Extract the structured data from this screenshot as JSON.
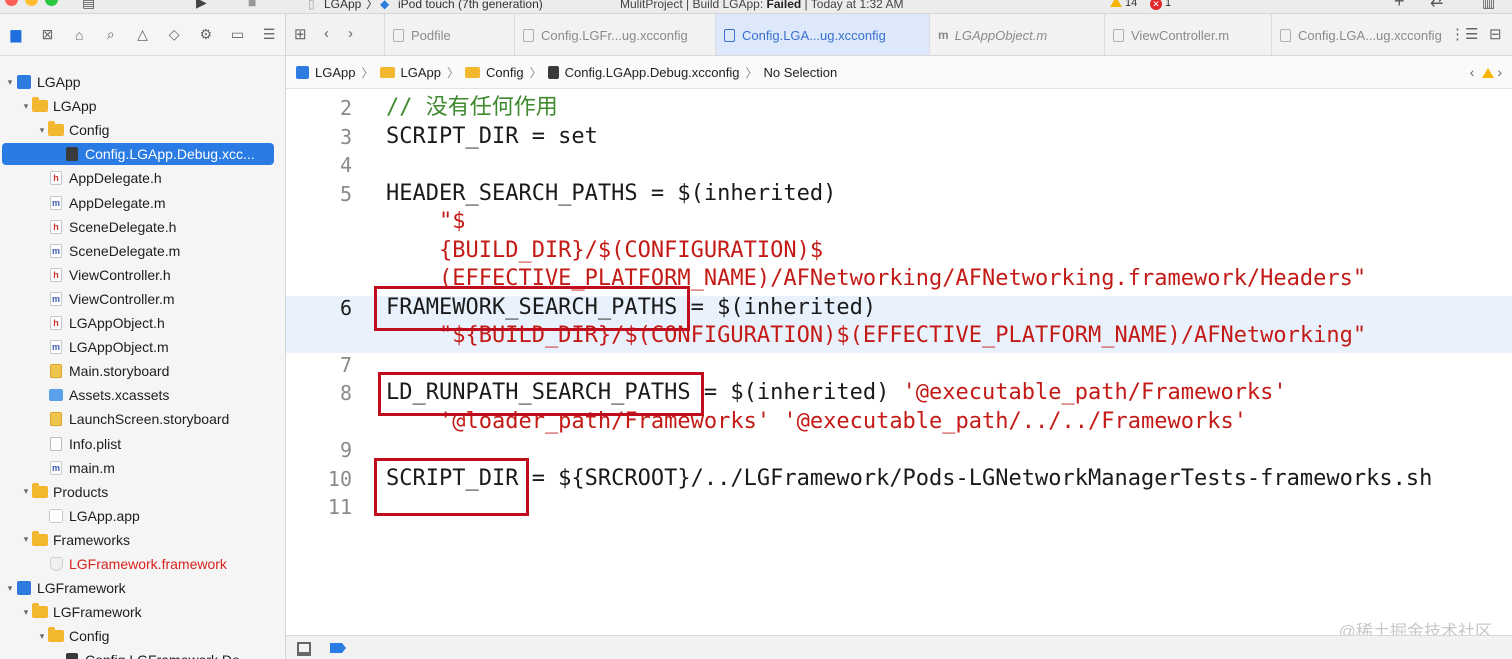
{
  "titlebar": {
    "scheme": "LGApp",
    "device": "iPod touch (7th generation)",
    "status_prefix": "MulitProject | Build LGApp: ",
    "status_result": "Failed",
    "status_suffix": " | Today at 1:32 AM",
    "warnings": "14",
    "errors": "1",
    "add_icon": "+",
    "swap_icon": "⇄"
  },
  "navigator": {
    "toolbar_icons": [
      "folder-icon",
      "source-control-icon",
      "symbols-icon",
      "search-icon",
      "issues-icon",
      "tests-icon",
      "debug-icon",
      "breakpoints-icon",
      "reports-icon"
    ],
    "tree": [
      {
        "label": "LGApp",
        "depth": 0,
        "icon": "project",
        "disclosure": "▾"
      },
      {
        "label": "LGApp",
        "depth": 1,
        "icon": "folder",
        "disclosure": "▾"
      },
      {
        "label": "Config",
        "depth": 2,
        "icon": "folder",
        "disclosure": "▾"
      },
      {
        "label": "Config.LGApp.Debug.xcc...",
        "depth": 3,
        "icon": "cfg",
        "selected": true
      },
      {
        "label": "AppDelegate.h",
        "depth": 2,
        "icon": "h"
      },
      {
        "label": "AppDelegate.m",
        "depth": 2,
        "icon": "m"
      },
      {
        "label": "SceneDelegate.h",
        "depth": 2,
        "icon": "h"
      },
      {
        "label": "SceneDelegate.m",
        "depth": 2,
        "icon": "m"
      },
      {
        "label": "ViewController.h",
        "depth": 2,
        "icon": "h"
      },
      {
        "label": "ViewController.m",
        "depth": 2,
        "icon": "m"
      },
      {
        "label": "LGAppObject.h",
        "depth": 2,
        "icon": "h"
      },
      {
        "label": "LGAppObject.m",
        "depth": 2,
        "icon": "m"
      },
      {
        "label": "Main.storyboard",
        "depth": 2,
        "icon": "story"
      },
      {
        "label": "Assets.xcassets",
        "depth": 2,
        "icon": "assets"
      },
      {
        "label": "LaunchScreen.storyboard",
        "depth": 2,
        "icon": "story"
      },
      {
        "label": "Info.plist",
        "depth": 2,
        "icon": "plist"
      },
      {
        "label": "main.m",
        "depth": 2,
        "icon": "m"
      },
      {
        "label": "Products",
        "depth": 1,
        "icon": "folder",
        "disclosure": "▾"
      },
      {
        "label": "LGApp.app",
        "depth": 2,
        "icon": "app"
      },
      {
        "label": "Frameworks",
        "depth": 1,
        "icon": "folder",
        "disclosure": "▾"
      },
      {
        "label": "LGFramework.framework",
        "depth": 2,
        "icon": "shield",
        "red": true
      },
      {
        "label": "LGFramework",
        "depth": 0,
        "icon": "project",
        "disclosure": "▾"
      },
      {
        "label": "LGFramework",
        "depth": 1,
        "icon": "folder",
        "disclosure": "▾"
      },
      {
        "label": "Config",
        "depth": 2,
        "icon": "folder",
        "disclosure": "▾"
      },
      {
        "label": "Config.LGFramework.De...",
        "depth": 3,
        "icon": "cfg"
      }
    ]
  },
  "tabs": [
    {
      "label": "Podfile",
      "active": false,
      "kind": "file"
    },
    {
      "label": "Config.LGFr...ug.xcconfig",
      "active": false,
      "kind": "file"
    },
    {
      "label": "Config.LGA...ug.xcconfig",
      "active": true,
      "kind": "file"
    },
    {
      "label": "LGAppObject.m",
      "active": false,
      "kind": "m",
      "italic": true
    },
    {
      "label": "ViewController.m",
      "active": false,
      "kind": "file"
    },
    {
      "label": "Config.LGA...ug.xcconfig",
      "active": false,
      "kind": "file"
    }
  ],
  "jumpbar": {
    "crumbs": [
      "LGApp",
      "LGApp",
      "Config",
      "Config.LGApp.Debug.xcconfig"
    ],
    "selection": "No Selection"
  },
  "editor": {
    "lines": [
      {
        "n": "2",
        "segments": [
          {
            "t": "// 没有任何作用",
            "c": "comment"
          }
        ]
      },
      {
        "n": "3",
        "segments": [
          {
            "t": "SCRIPT_DIR = set",
            "c": "plain"
          }
        ]
      },
      {
        "n": "4",
        "segments": []
      },
      {
        "n": "5",
        "segments": [
          {
            "t": "HEADER_SEARCH_PATHS = $(inherited)",
            "c": "plain"
          }
        ]
      },
      {
        "n": "",
        "segments": [
          {
            "t": "    \"$",
            "c": "str"
          }
        ]
      },
      {
        "n": "",
        "segments": [
          {
            "t": "    {BUILD_DIR}/$(CONFIGURATION)$",
            "c": "str"
          }
        ]
      },
      {
        "n": "",
        "segments": [
          {
            "t": "    (EFFECTIVE_PLATFORM_NAME)/AFNetworking/AFNetworking.framework/Headers\"",
            "c": "str"
          }
        ]
      },
      {
        "n": "6",
        "current": true,
        "segments": [
          {
            "t": "FRAMEWORK_SEARCH_PATHS = $(inherited)",
            "c": "plain"
          }
        ]
      },
      {
        "n": "",
        "segments": [
          {
            "t": "    \"${BUILD_DIR}/$(CONFIGURATION)$(EFFECTIVE_PLATFORM_NAME)/AFNetworking\"",
            "c": "str"
          }
        ]
      },
      {
        "n": "7",
        "segments": []
      },
      {
        "n": "8",
        "segments": [
          {
            "t": "LD_RUNPATH_SEARCH_PATHS = $(inherited) ",
            "c": "plain"
          },
          {
            "t": "'@executable_path/Frameworks'",
            "c": "str"
          }
        ]
      },
      {
        "n": "",
        "segments": [
          {
            "t": "    '@loader_path/Frameworks' '@executable_path/../../Frameworks'",
            "c": "str"
          }
        ]
      },
      {
        "n": "9",
        "segments": []
      },
      {
        "n": "10",
        "segments": [
          {
            "t": "SCRIPT_DIR = ${SRCROOT}/../LGFramework/Pods-LGNetworkManagerTests-frameworks.sh",
            "c": "plain"
          }
        ]
      },
      {
        "n": "11",
        "segments": []
      }
    ]
  },
  "colors": {
    "comment": "#3e8a2e",
    "string": "#c41a16",
    "highlight_box": "#c00d1e",
    "selection": "#2a7be4"
  },
  "watermark": "@稀土掘金技术社区"
}
